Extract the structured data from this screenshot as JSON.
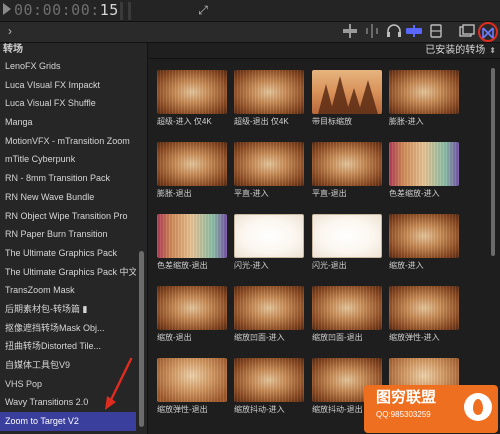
{
  "timecode": {
    "display": "00:00:00:15",
    "lit_part": "15",
    "dim_part": "00:00:00:"
  },
  "sidebar": {
    "title": "转场",
    "items": [
      {
        "label": "LenoFX Grids"
      },
      {
        "label": "Luca VIsual FX Impackt"
      },
      {
        "label": "Luca Visual FX Shuffle"
      },
      {
        "label": "Manga"
      },
      {
        "label": "MotionVFX - mTransition Zoom"
      },
      {
        "label": "mTitle Cyberpunk"
      },
      {
        "label": "RN - 8mm Transition Pack"
      },
      {
        "label": "RN New Wave Bundle"
      },
      {
        "label": "RN Object Wipe Transition Pro"
      },
      {
        "label": "RN Paper Burn Transition"
      },
      {
        "label": "The Ultimate Graphics Pack"
      },
      {
        "label": "The Ultimate Graphics Pack 中文"
      },
      {
        "label": "TransZoom Mask"
      },
      {
        "label": "后期素材包-转场篇 ▮"
      },
      {
        "label": "抠像遮挡转场Mask Obj..."
      },
      {
        "label": "扭曲转场Distorted Tile..."
      },
      {
        "label": "自媒体工具包V9"
      },
      {
        "label": "VHS Pop"
      },
      {
        "label": "Wavy Transitions 2.0"
      },
      {
        "label": "Zoom to Target V2"
      }
    ],
    "selected_index": 19
  },
  "browser": {
    "filter_label": "已安装的转场",
    "tiles": [
      {
        "label": "超级-进入 仅4K",
        "style": "t-zoom"
      },
      {
        "label": "超级-退出 仅4K",
        "style": "t-zoom"
      },
      {
        "label": "带目标缩放",
        "style": "t-trees"
      },
      {
        "label": "膨胀-进入",
        "style": "t-zoom"
      },
      {
        "label": "膨胀-退出",
        "style": "t-zoom"
      },
      {
        "label": "平直-进入",
        "style": "t-zoom"
      },
      {
        "label": "平直-退出",
        "style": "t-zoom"
      },
      {
        "label": "色差缩放-进入",
        "style": "t-color"
      },
      {
        "label": "色差缩放-退出",
        "style": "t-color"
      },
      {
        "label": "闪光-进入",
        "style": "t-white"
      },
      {
        "label": "闪光-退出",
        "style": "t-white"
      },
      {
        "label": "缩放-进入",
        "style": "t-zoom"
      },
      {
        "label": "缩放-退出",
        "style": "t-zoom"
      },
      {
        "label": "缩放凹面-进入",
        "style": "t-zoom"
      },
      {
        "label": "缩放凹面-退出",
        "style": "t-zoom"
      },
      {
        "label": "缩放弹性-进入",
        "style": "t-zoom"
      },
      {
        "label": "缩放弹性-退出",
        "style": "t-warm"
      },
      {
        "label": "缩放抖动-进入",
        "style": "t-zoom"
      },
      {
        "label": "缩放抖动-退出",
        "style": "t-zoom"
      },
      {
        "label": "",
        "style": "t-warm"
      }
    ]
  },
  "watermark": {
    "title": "图穷联盟",
    "subtitle": "QQ:985303259"
  },
  "colors": {
    "selection": "#3a3f9e",
    "accent_active": "#6f7bff",
    "highlight_circle": "#e02c20",
    "annotation_arrow": "#e02c20"
  },
  "icons": {
    "toolbar": [
      "waveform-icon",
      "waveform-split-icon",
      "headphones-icon",
      "skimming-icon",
      "filmstrip-icon",
      "browser-icon",
      "transitions-icon"
    ]
  }
}
